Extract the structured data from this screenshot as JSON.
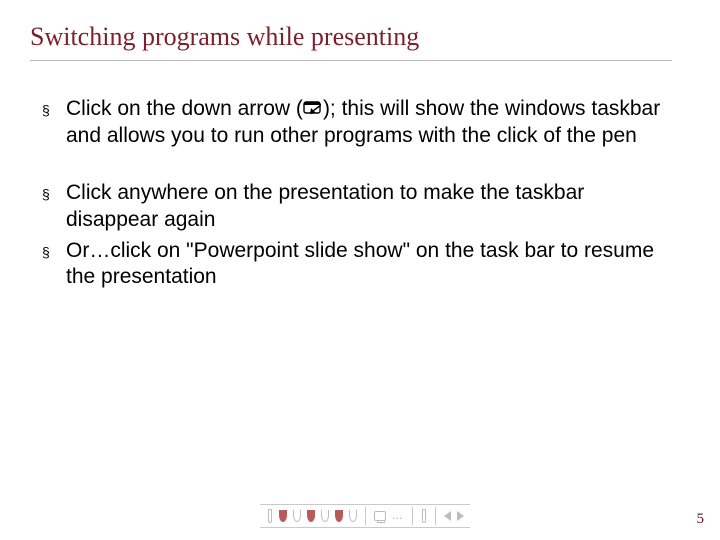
{
  "title": "Switching programs while presenting",
  "groups": [
    {
      "items": [
        {
          "pre": "Click on the down arrow (",
          "glyph": "screen-arrow",
          "post": "); this will show the windows taskbar and allows you to run other programs with the click of the pen"
        }
      ]
    },
    {
      "items": [
        {
          "text": "Click anywhere on the presentation to make the taskbar disappear again"
        },
        {
          "text": "Or…click on \"Powerpoint slide show\" on the task bar to resume the presentation"
        }
      ]
    }
  ],
  "toolbar": {
    "dots": "…"
  },
  "page_number": "5",
  "bullet_marker": "§"
}
